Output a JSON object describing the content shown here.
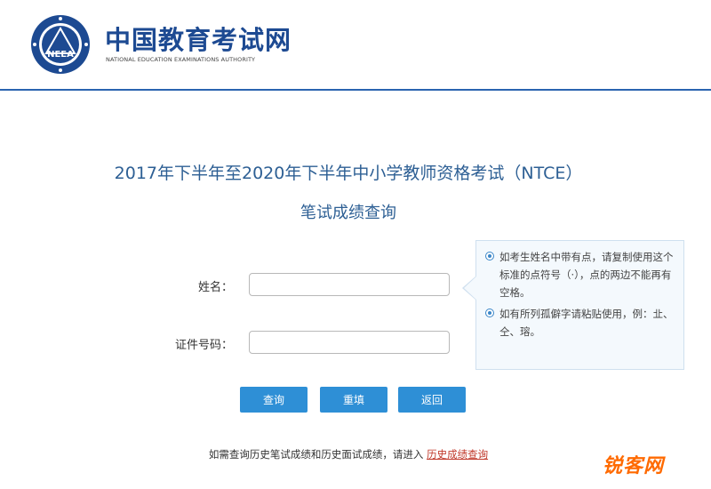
{
  "header": {
    "brand_cn": "中国教育考试网",
    "brand_en": "NATIONAL EDUCATION EXAMINATIONS AUTHORITY",
    "logo_text": "NEEA",
    "brand_color": "#1d4a92"
  },
  "main": {
    "title_line1": "2017年下半年至2020年下半年中小学教师资格考试（NTCE）",
    "title_line2": "笔试成绩查询",
    "form": {
      "name_label": "姓名：",
      "name_value": "",
      "id_label": "证件号码：",
      "id_value": ""
    },
    "tips": [
      "如考生姓名中带有点，请复制使用这个标准的点符号（·），点的两边不能再有空格。",
      "如有所列孤僻字请粘贴使用，例：㐀、仝、瑢。"
    ],
    "buttons": {
      "query": "查询",
      "reset": "重填",
      "back": "返回"
    },
    "footer": {
      "text": "如需查询历史笔试成绩和历史面试成绩，请进入",
      "link": "历史成绩查询"
    }
  },
  "watermark": {
    "text": "锐客网",
    "color": "#ff6a00"
  }
}
